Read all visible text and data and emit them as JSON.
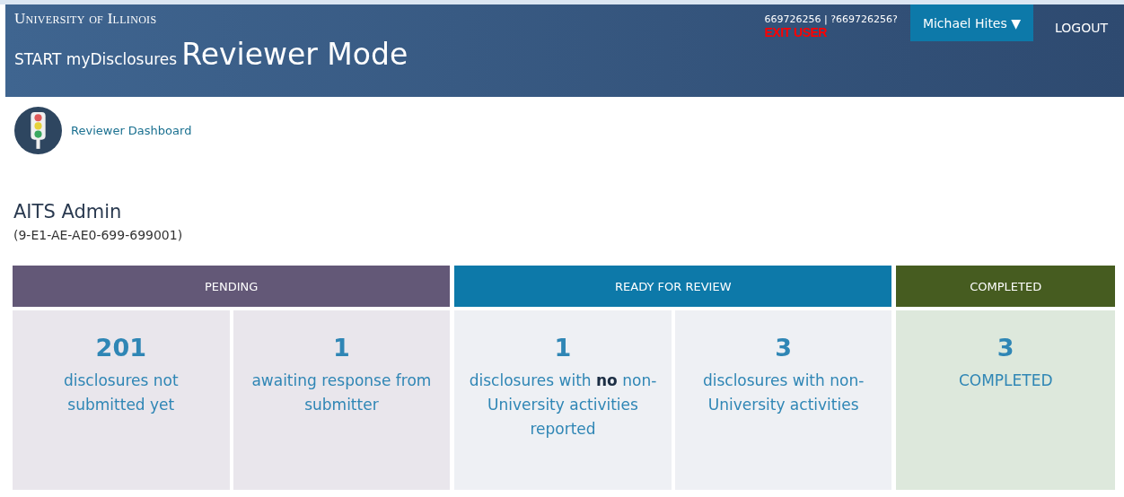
{
  "header": {
    "institution": "University of Illinois",
    "app_prefix": "START myDisclosures",
    "mode_title": "Reviewer Mode",
    "user_ids": "669726256 | ?669726256?",
    "exit_user": "EXIT USER",
    "user_menu": "Michael Hites ▼",
    "logout": "LOGOUT"
  },
  "breadcrumb": {
    "label": "Reviewer Dashboard"
  },
  "reviewer": {
    "name": "AITS Admin",
    "code": "(9-E1-AE-AE0-699-699001)"
  },
  "groups": [
    {
      "kind": "pending",
      "color": "#635877",
      "title": "PENDING",
      "cells": [
        {
          "count": "201",
          "text": "disclosures not submitted yet"
        },
        {
          "count": "1",
          "text": "awaiting response from submitter"
        }
      ]
    },
    {
      "kind": "review",
      "color": "#0d79a9",
      "title": "READY FOR REVIEW",
      "cells": [
        {
          "count": "1",
          "text": "disclosures with **no** non-University activities reported"
        },
        {
          "count": "3",
          "text": "disclosures with non-University activities"
        }
      ]
    },
    {
      "kind": "completed",
      "color": "#465c20",
      "title": "COMPLETED",
      "cells": [
        {
          "count": "3",
          "text": "COMPLETED"
        }
      ]
    }
  ]
}
